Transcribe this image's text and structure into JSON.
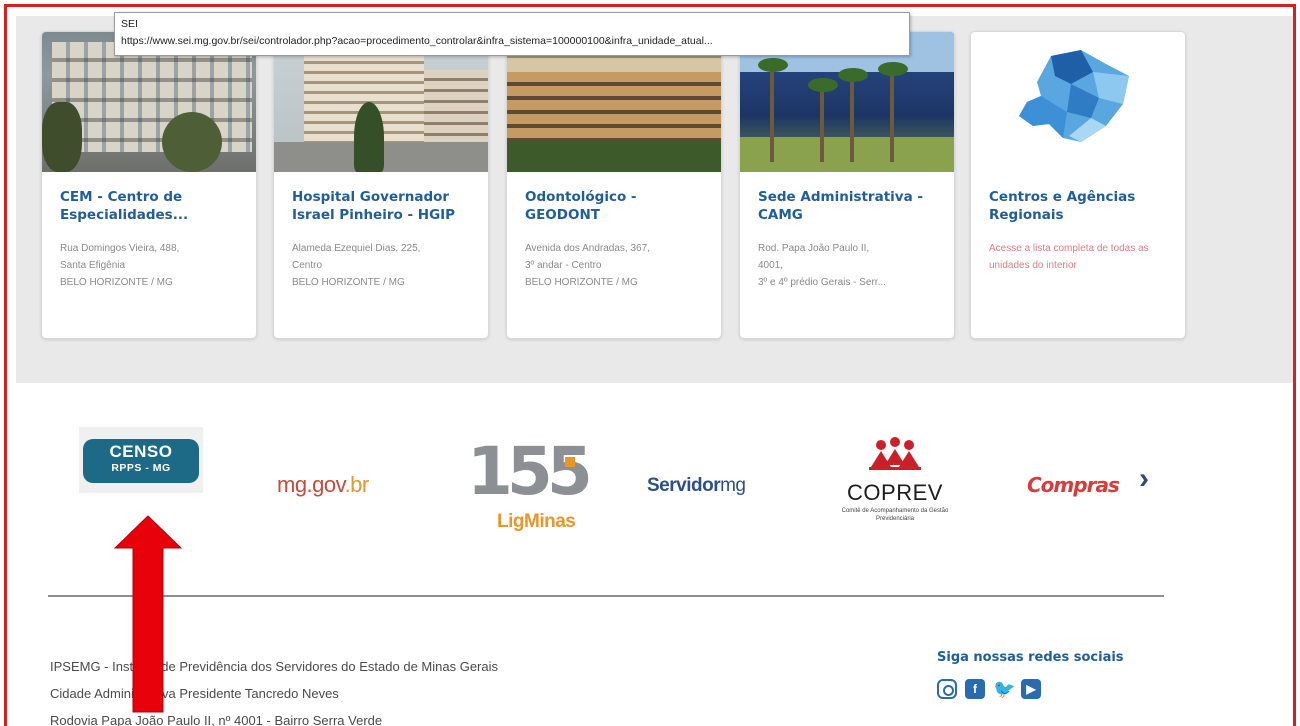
{
  "tooltip": {
    "title": "SEI",
    "url": "https://www.sei.mg.gov.br/sei/controlador.php?acao=procedimento_controlar&infra_sistema=100000100&infra_unidade_atual..."
  },
  "cards": [
    {
      "title": "CEM - Centro de Especialidades...",
      "lines": [
        "Rua Domingos Vieira, 488,",
        "Santa Efigênia",
        "BELO HORIZONTE / MG"
      ]
    },
    {
      "title": "Hospital Governador Israel Pinheiro - HGIP",
      "lines": [
        "Alameda Ezequiel Dias, 225,",
        "Centro",
        "BELO HORIZONTE / MG"
      ]
    },
    {
      "title": "Odontológico - GEODONT",
      "lines": [
        "Avenida dos Andradas, 367,",
        "3º andar - Centro",
        "BELO HORIZONTE / MG"
      ]
    },
    {
      "title": "Sede Administrativa - CAMG",
      "lines": [
        "Rod. Papa João Paulo II,",
        "4001,",
        "3º e 4º prédio Gerais - Serr..."
      ]
    },
    {
      "title": "Centros e Agências Regionais",
      "lines": [
        "Acesse a lista completa de todas as unidades do interior"
      ]
    }
  ],
  "logos": {
    "censo": {
      "line1": "CENSO",
      "line2": "RPPS - MG"
    },
    "mggov": {
      "main": "mg.gov",
      "tail": ".br"
    },
    "l155": {
      "num": "155",
      "sub": "LigMinas"
    },
    "servidor": {
      "main": "Servidor",
      "mg": "mg"
    },
    "coprev": {
      "word": "COPREV",
      "small": "Comitê de Acompanhamento da Gestão Previdenciária"
    },
    "compras": {
      "main": "Compras"
    },
    "next_icon": "›"
  },
  "footer": {
    "lines": [
      "IPSEMG - Instituto de Previdência dos Servidores do Estado de Minas Gerais",
      "Cidade Administrativa Presidente Tancredo Neves",
      "Rodovia Papa João Paulo II, nº 4001 - Bairro Serra Verde"
    ],
    "social_title": "Siga nossas redes sociais",
    "social": [
      "instagram-icon",
      "facebook-icon",
      "twitter-icon",
      "youtube-icon"
    ]
  },
  "colors": {
    "frame": "#d42020",
    "card_title": "#1f5d9b",
    "link_pink": "#e07b8a",
    "arrow": "#e8000b"
  }
}
